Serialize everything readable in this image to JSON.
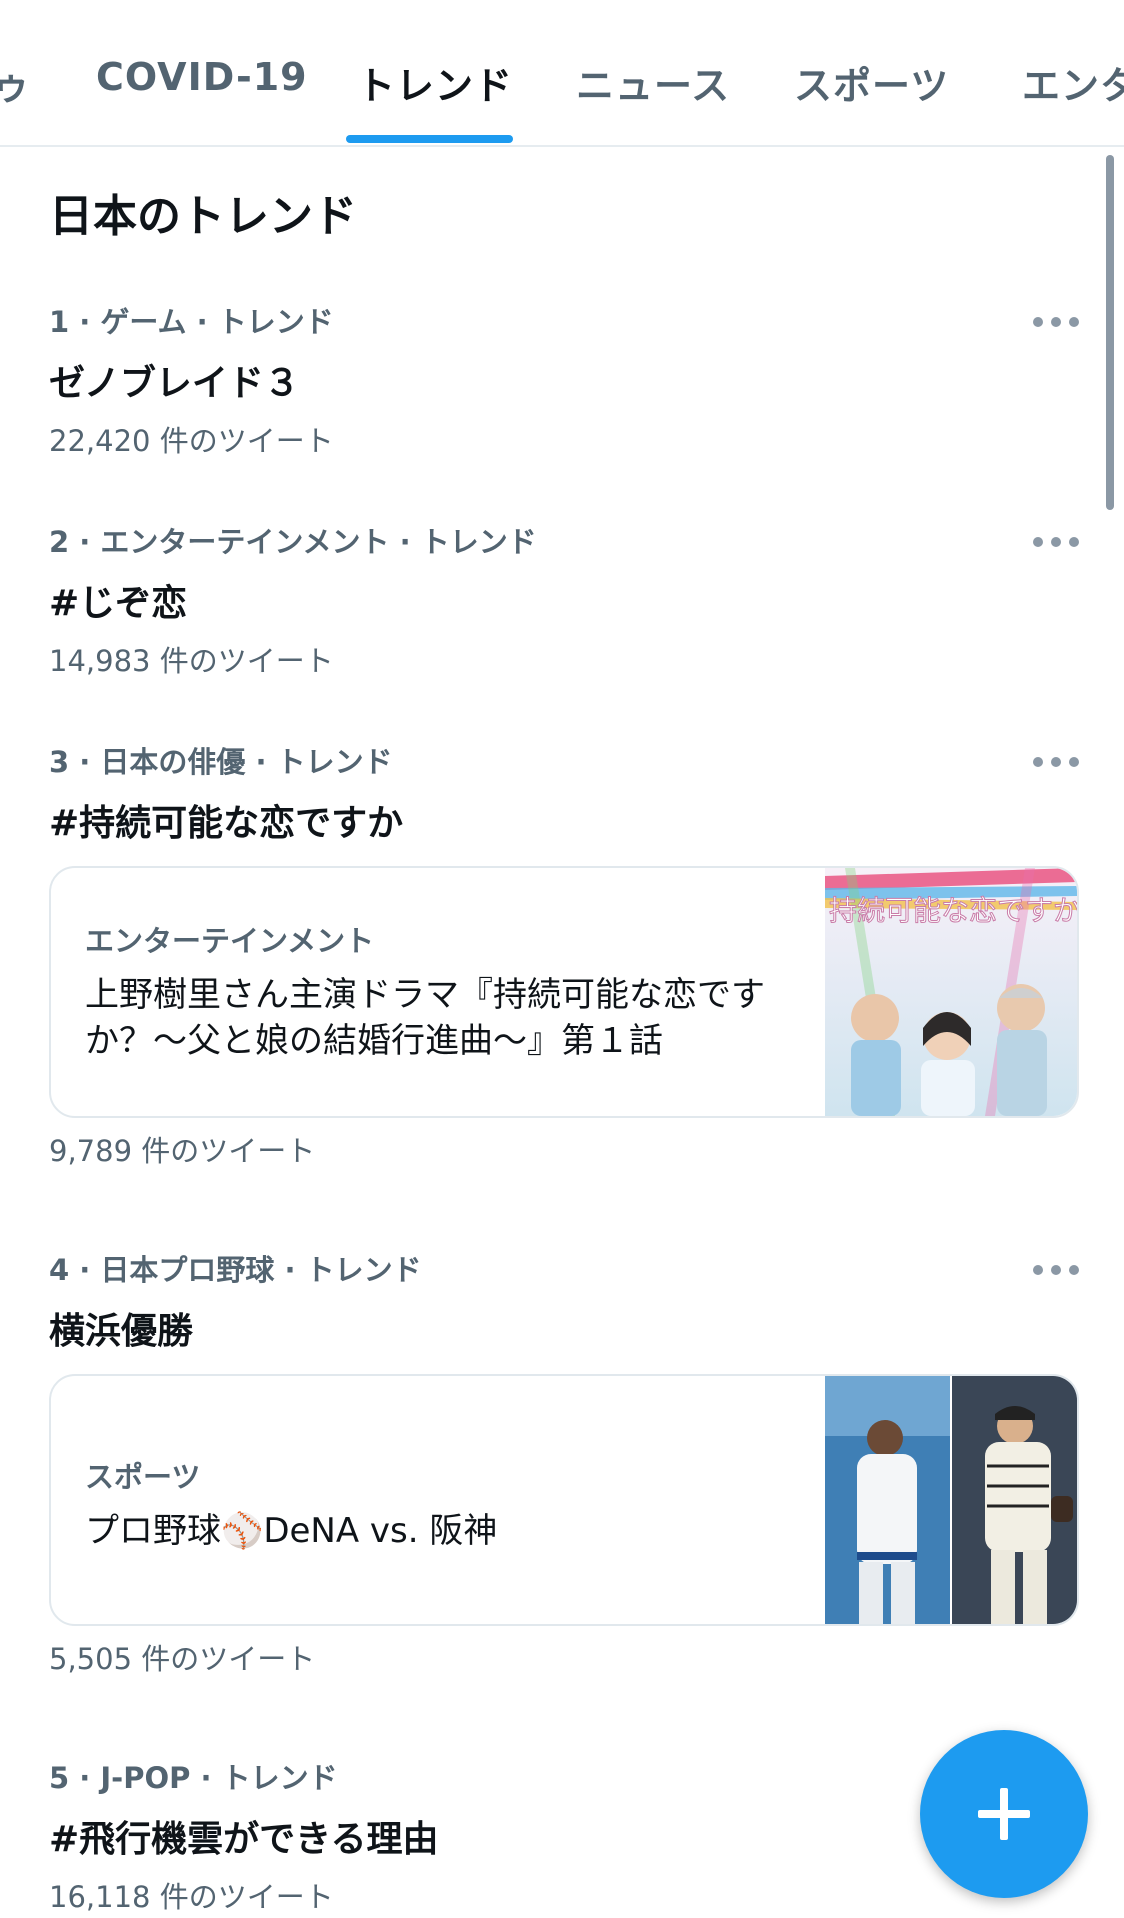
{
  "tabs": {
    "partial_left": "ゥ",
    "items": [
      {
        "label": "COVID-19"
      },
      {
        "label": "トレンド",
        "active": true
      },
      {
        "label": "ニュース"
      },
      {
        "label": "スポーツ"
      },
      {
        "label": "エンタ"
      }
    ]
  },
  "section_title": "日本のトレンド",
  "trends": [
    {
      "meta": "1 · ゲーム · トレンド",
      "name": "ゼノブレイド３",
      "count": "22,420 件のツイート"
    },
    {
      "meta": "2 · エンターテインメント · トレンド",
      "name": "#じぞ恋",
      "count": "14,983 件のツイート"
    },
    {
      "meta": "3 · 日本の俳優 · トレンド",
      "name": "#持続可能な恋ですか",
      "count": "9,789 件のツイート",
      "card": {
        "category": "エンターテインメント",
        "title": "上野樹里さん主演ドラマ『持続可能な恋ですか？〜父と娘の結婚行進曲〜』第１話",
        "thumb_caption": "持続可能な恋ですか"
      }
    },
    {
      "meta": "4 · 日本プロ野球 · トレンド",
      "name": "横浜優勝",
      "count": "5,505 件のツイート",
      "card": {
        "category": "スポーツ",
        "title": "プロ野球⚾DeNA vs. 阪神"
      }
    },
    {
      "meta": "5 · J-POP · トレンド",
      "name": "#飛行機雲ができる理由",
      "count": "16,118 件のツイート"
    }
  ],
  "colors": {
    "accent": "#1d9bf0",
    "muted": "#536471"
  },
  "icons": {
    "more": "more-horizontal-icon",
    "compose": "plus-icon"
  }
}
